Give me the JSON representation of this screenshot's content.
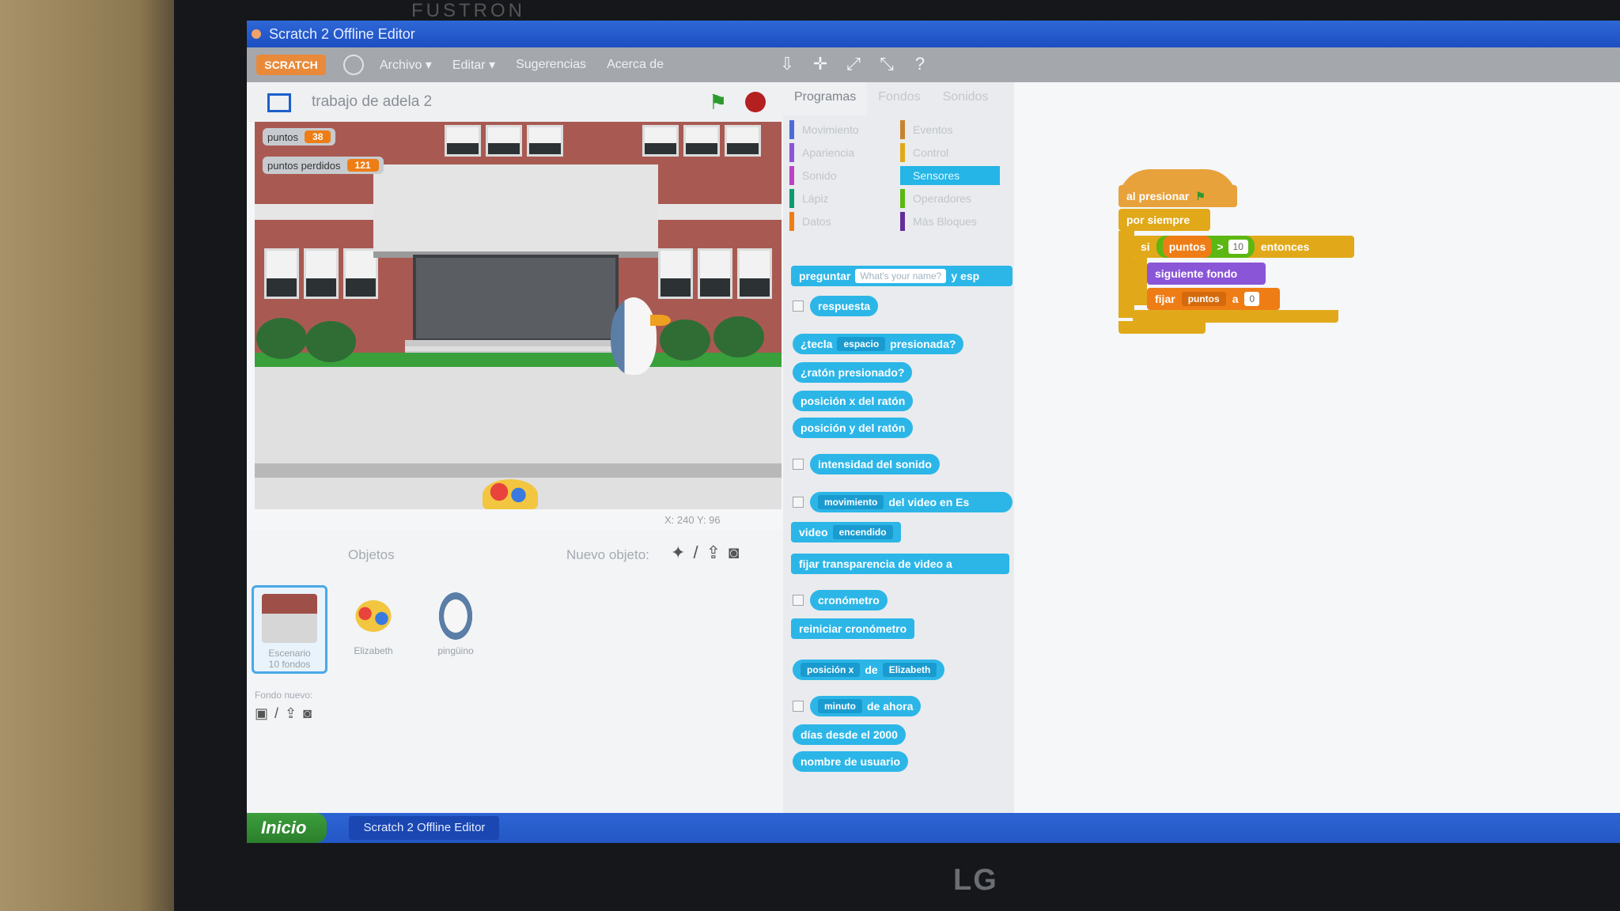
{
  "window": {
    "title": "Scratch 2 Offline Editor"
  },
  "menu": {
    "logo": "SCRATCH",
    "items": [
      "Archivo ▾",
      "Editar ▾",
      "Sugerencias",
      "Acerca de"
    ]
  },
  "stage": {
    "project_title": "trabajo de adela 2",
    "monitors": [
      {
        "label": "puntos",
        "value": "38"
      },
      {
        "label": "puntos perdidos",
        "value": "121"
      }
    ],
    "coords": "X: 240  Y: 96"
  },
  "sprites": {
    "title": "Objetos",
    "new_sprite": "Nuevo objeto:",
    "stage_tile": {
      "name": "Escenario",
      "sub": "10 fondos"
    },
    "items": [
      "Elizabeth",
      "pingüino"
    ],
    "new_backdrop": "Fondo nuevo:"
  },
  "tabs": [
    "Programas",
    "Fondos",
    "Sonidos"
  ],
  "categories": [
    {
      "name": "Movimiento",
      "color": "#4a6cd4"
    },
    {
      "name": "Eventos",
      "color": "#c88330"
    },
    {
      "name": "Apariencia",
      "color": "#8a55d7"
    },
    {
      "name": "Control",
      "color": "#e1a91a"
    },
    {
      "name": "Sonido",
      "color": "#bb42c3"
    },
    {
      "name": "Sensores",
      "color": "#2ca5e2"
    },
    {
      "name": "Lápiz",
      "color": "#0e9a6c"
    },
    {
      "name": "Operadores",
      "color": "#5cb712"
    },
    {
      "name": "Datos",
      "color": "#ee7d16"
    },
    {
      "name": "Más Bloques",
      "color": "#632d99"
    }
  ],
  "palette": {
    "ask": {
      "label": "preguntar",
      "slot": "What's your name?",
      "tail": "y esp"
    },
    "answer": "respuesta",
    "key_pressed": {
      "pre": "¿tecla",
      "slot": "espacio",
      "post": "presionada?"
    },
    "mouse_down": "¿ratón presionado?",
    "mouse_x": "posición x del ratón",
    "mouse_y": "posición y del ratón",
    "loudness": "intensidad del sonido",
    "video_motion": {
      "slot": "movimiento",
      "post": "del video en Es"
    },
    "video_on": {
      "label": "video",
      "slot": "encendido"
    },
    "video_transparency": "fijar transparencia de video a",
    "timer": "cronómetro",
    "reset_timer": "reiniciar cronómetro",
    "of": {
      "slot": "posición x",
      "mid": "de",
      "target": "Elizabeth"
    },
    "current": {
      "slot": "minuto",
      "post": "de ahora"
    },
    "days_since": "días desde el 2000",
    "username": "nombre de usuario"
  },
  "script": {
    "when_flag": "al presionar",
    "forever": "por siempre",
    "if_label": "si",
    "var": "puntos",
    "op": ">",
    "num": "10",
    "then": "entonces",
    "next_backdrop": "siguiente fondo",
    "set": "fijar",
    "set_var": "puntos",
    "to": "a",
    "set_val": "0"
  },
  "taskbar": {
    "start": "Inicio",
    "app": "Scratch 2 Offline Editor"
  },
  "monitor_brand": "FUSTRON",
  "brand_logo": "LG"
}
